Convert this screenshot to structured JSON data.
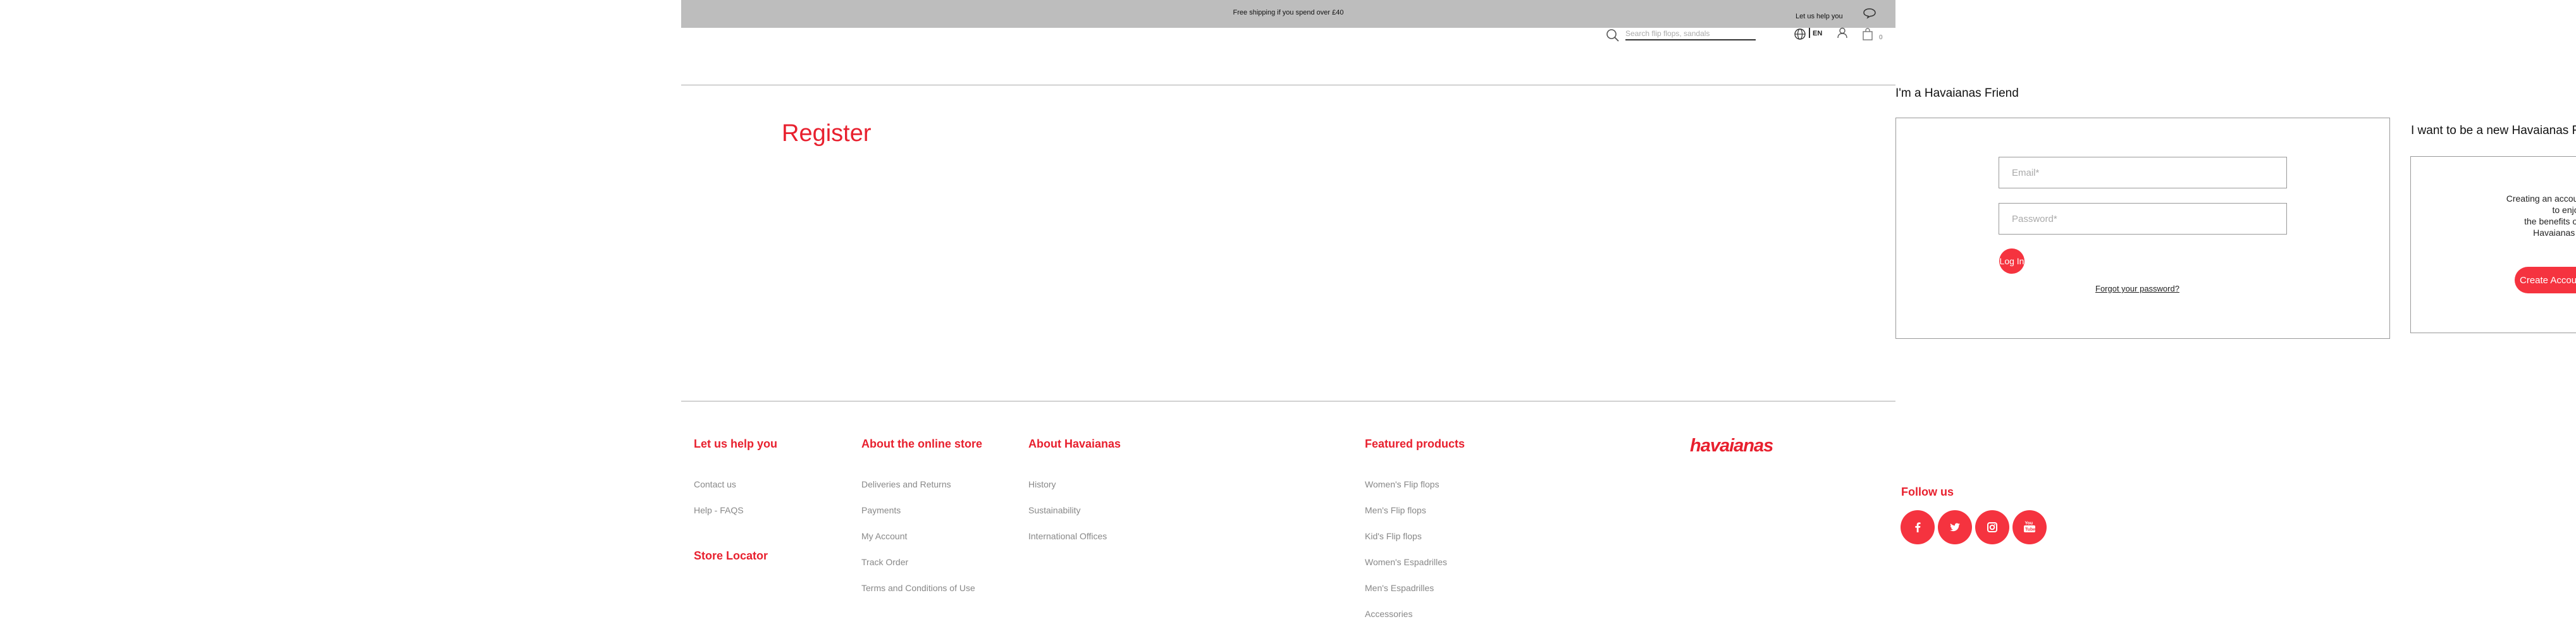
{
  "topbar": {
    "shipping": "Free shipping if you spend over £40",
    "help": "Let us help you",
    "chat_icon": "chat-bubble-icon"
  },
  "header": {
    "search_placeholder": "Search flip flops, sandals",
    "language": "EN",
    "bag_count": "0",
    "icons": [
      "search-icon",
      "globe-icon",
      "user-icon",
      "bag-icon"
    ]
  },
  "page": {
    "title": "Register"
  },
  "login": {
    "title": "I'm a Havaianas Friend",
    "email_placeholder": "Email*",
    "password_placeholder": "Password*",
    "login_button": "Log In",
    "forgot": "Forgot your password?"
  },
  "new_account": {
    "title": "I want to be a new Havaianas Friend",
    "text_line1": "Creating an account allows you to enjoy",
    "text_line2": "the benefits of being a Havaianas Friend",
    "button": "Create Account"
  },
  "footer": {
    "help": {
      "title": "Let us help you",
      "links": [
        "Contact us",
        "Help - FAQS"
      ],
      "store_locator": "Store Locator"
    },
    "store": {
      "title": "About the online store",
      "links": [
        "Deliveries and Returns",
        "Payments",
        "My Account",
        "Track Order",
        "Terms and Conditions of Use"
      ]
    },
    "about": {
      "title": "About Havaianas",
      "links": [
        "History",
        "Sustainability",
        "International Offices"
      ]
    },
    "featured": {
      "title": "Featured products",
      "links": [
        "Women's Flip flops",
        "Men's Flip flops",
        "Kid's Flip flops",
        "Women's Espadrilles",
        "Men's Espadrilles",
        "Accessories"
      ]
    },
    "logo_text": "havaianas",
    "follow": {
      "title": "Follow us",
      "networks": [
        "facebook-icon",
        "twitter-icon",
        "instagram-icon",
        "youtube-icon"
      ]
    }
  },
  "colors": {
    "brand_red": "#e8202e",
    "button_red": "#f5333f",
    "topbar_grey": "#bdbdbd"
  }
}
